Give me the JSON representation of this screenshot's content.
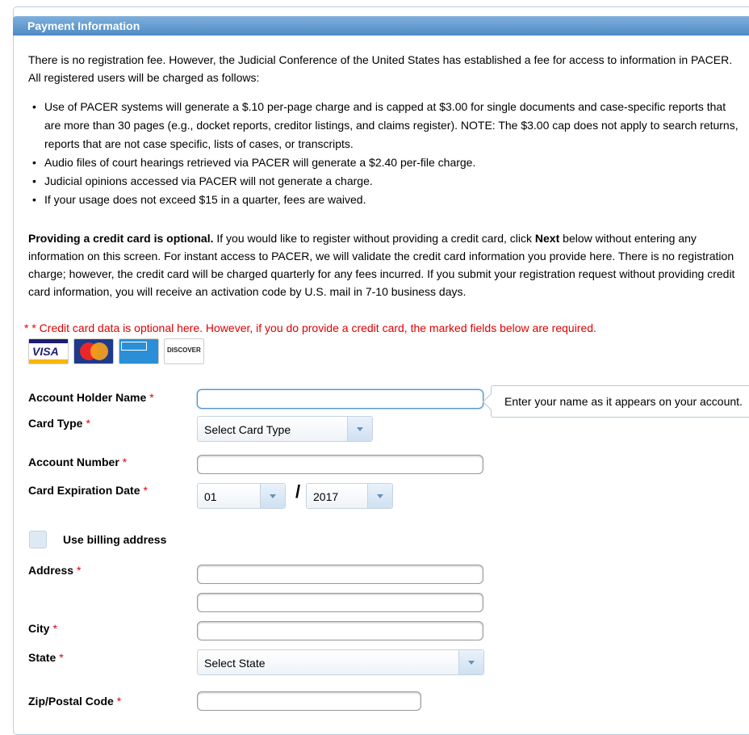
{
  "header": {
    "title": "Payment Information"
  },
  "intro": "There is no registration fee. However, the Judicial Conference of the United States has established a fee for access to information in PACER. All registered users will be charged as follows:",
  "fees": [
    "Use of PACER systems will generate a $.10 per-page charge and is capped at $3.00 for single documents and case-specific reports that are more than 30 pages (e.g., docket reports, creditor listings, and claims register). NOTE: The $3.00 cap does not apply to search returns, reports that are not case specific, lists of cases, or transcripts.",
    "Audio files of court hearings retrieved via PACER will generate a $2.40 per-file charge.",
    "Judicial opinions accessed via PACER will not generate a charge.",
    "If your usage does not exceed $15 in a quarter, fees are waived."
  ],
  "optional": {
    "bold_lead": "Providing a credit card is optional.",
    "text_before_next": " If you would like to register without providing a credit card, click ",
    "next_word": "Next",
    "text_after_next": " below without entering any information on this screen. For instant access to PACER, we will validate the credit card information you provide here. There is no registration charge; however, the credit card will be charged quarterly for any fees incurred. If you submit your registration request without providing credit card information, you will receive an activation code by U.S. mail in 7-10 business days."
  },
  "required_note": "* * Credit card data is optional here. However, if you do provide a credit card, the marked fields below are required.",
  "card_logos": {
    "visa": "VISA",
    "mastercard": "MasterCard",
    "amex": "American Express",
    "discover": "DISCOVER"
  },
  "form": {
    "required_mark": "*",
    "account_holder_label": "Account Holder Name",
    "account_holder_value": "",
    "account_holder_tooltip": "Enter your name as it appears on your account.",
    "card_type_label": "Card Type",
    "card_type_value": "Select Card Type",
    "account_number_label": "Account Number",
    "account_number_value": "",
    "expiration_label": "Card Expiration Date",
    "exp_month": "01",
    "exp_separator": "/",
    "exp_year": "2017",
    "billing_label": "Use billing address",
    "address_label": "Address",
    "city_label": "City",
    "state_label": "State",
    "state_value": "Select State",
    "zip_label": "Zip/Postal Code"
  },
  "colors": {
    "header_bg": "#5b97cf",
    "required": "#e00000"
  }
}
